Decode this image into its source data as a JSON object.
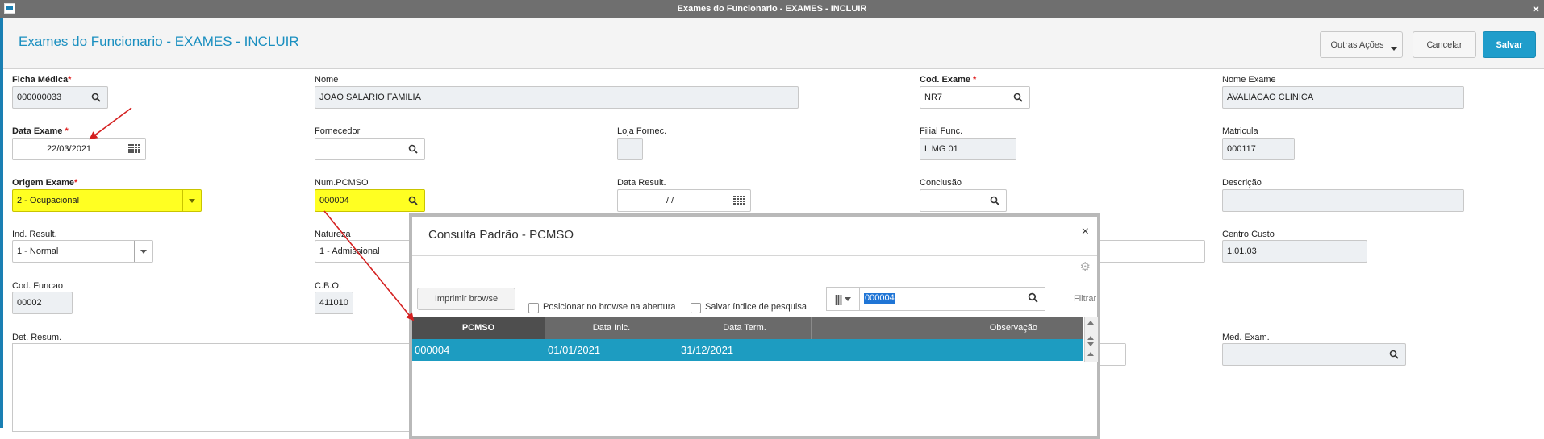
{
  "window": {
    "title": "Exames do Funcionario - EXAMES - INCLUIR",
    "close_glyph": "×"
  },
  "header": {
    "title": "Exames do Funcionario - EXAMES - INCLUIR",
    "other_actions_label": "Outras Ações",
    "cancel_label": "Cancelar",
    "save_label": "Salvar"
  },
  "form": {
    "required_mark": "*",
    "ficha_medica": {
      "label": "Ficha Médica",
      "value": "000000033"
    },
    "nome": {
      "label": "Nome",
      "value": "JOAO SALARIO FAMILIA"
    },
    "cod_exame": {
      "label": "Cod. Exame ",
      "value": "NR7"
    },
    "nome_exame": {
      "label": "Nome Exame",
      "value": "AVALIACAO CLINICA"
    },
    "data_exame": {
      "label": "Data Exame ",
      "value": "22/03/2021"
    },
    "fornecedor": {
      "label": "Fornecedor",
      "value": ""
    },
    "loja_fornec": {
      "label": "Loja Fornec.",
      "value": ""
    },
    "filial_func": {
      "label": "Filial Func.",
      "value": "L MG 01"
    },
    "matricula": {
      "label": "Matricula",
      "value": "000117"
    },
    "origem_exame": {
      "label": "Origem Exame",
      "value": "2 - Ocupacional"
    },
    "num_pcmso": {
      "label": "Num.PCMSO",
      "value": "000004"
    },
    "data_result": {
      "label": "Data Result.",
      "value": "/ /"
    },
    "conclusao": {
      "label": "Conclusão",
      "value": ""
    },
    "descricao": {
      "label": "Descrição",
      "value": ""
    },
    "ind_result": {
      "label": "Ind. Result.",
      "value": "1 - Normal"
    },
    "natureza": {
      "label": "Natureza",
      "value": "1 - Admissional"
    },
    "centro_custo": {
      "label": "Centro Custo",
      "value": "1.01.03"
    },
    "cod_funcao": {
      "label": "Cod. Funcao",
      "value": "00002"
    },
    "cbo": {
      "label": "C.B.O.",
      "value": "411010"
    },
    "det_resum": {
      "label": "Det. Resum.",
      "value": ""
    },
    "med_exam": {
      "label": "Med. Exam.",
      "value": ""
    }
  },
  "dialog": {
    "title": "Consulta Padrão - PCMSO",
    "close_glyph": "×",
    "settings_glyph": "⚙",
    "print_label": "Imprimir browse",
    "position_label": "Posicionar no browse na abertura",
    "save_index_label": "Salvar índice de pesquisa",
    "column_selector_glyph": "|||",
    "search_value": "000004",
    "filter_label": "Filtrar",
    "columns": [
      "PCMSO",
      "Data Inic.",
      "Data Term.",
      "Observação"
    ],
    "rows": [
      {
        "pcmso": "000004",
        "data_inic": "01/01/2021",
        "data_term": "31/12/2021",
        "observacao": ""
      }
    ]
  },
  "colors": {
    "accent": "#1a8fc0",
    "save_button": "#1f9dcb",
    "required_field": "#ffff22",
    "selected_row": "#1d9cc1",
    "annotation_arrow": "#d42020"
  }
}
